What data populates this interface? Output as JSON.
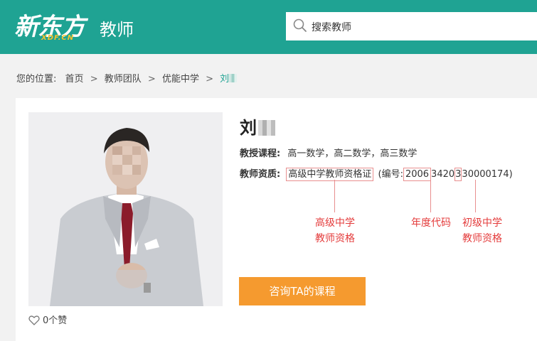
{
  "header": {
    "logo_text": "新东方",
    "logo_sub": "XDF.CN",
    "title": "教师",
    "search_text": "搜索教师"
  },
  "breadcrumb": {
    "prefix": "您的位置:",
    "items": [
      "首页",
      "教师团队",
      "优能中学",
      "刘"
    ],
    "separator": ">"
  },
  "teacher": {
    "name": "刘",
    "courses_label": "教授课程:",
    "courses": "高一数学，高二数学，高三数学",
    "cert_label": "教师资质:",
    "cert_name": "高级中学教师资格证",
    "cert_number_prefix": "(编号:",
    "cert_number_year": "2006",
    "cert_number_mid": "3420",
    "cert_number_digit": "3",
    "cert_number_rest": "30000174)",
    "likes": "0个赞",
    "consult_button": "咨询TA的课程"
  },
  "annotations": [
    {
      "line1": "高级中学",
      "line2": "教师资格"
    },
    {
      "line1": "年度代码"
    },
    {
      "line1": "初级中学",
      "line2": "教师资格"
    }
  ],
  "colors": {
    "brand": "#1fa393",
    "annotation": "#e43c3c",
    "button": "#f59a2f"
  }
}
